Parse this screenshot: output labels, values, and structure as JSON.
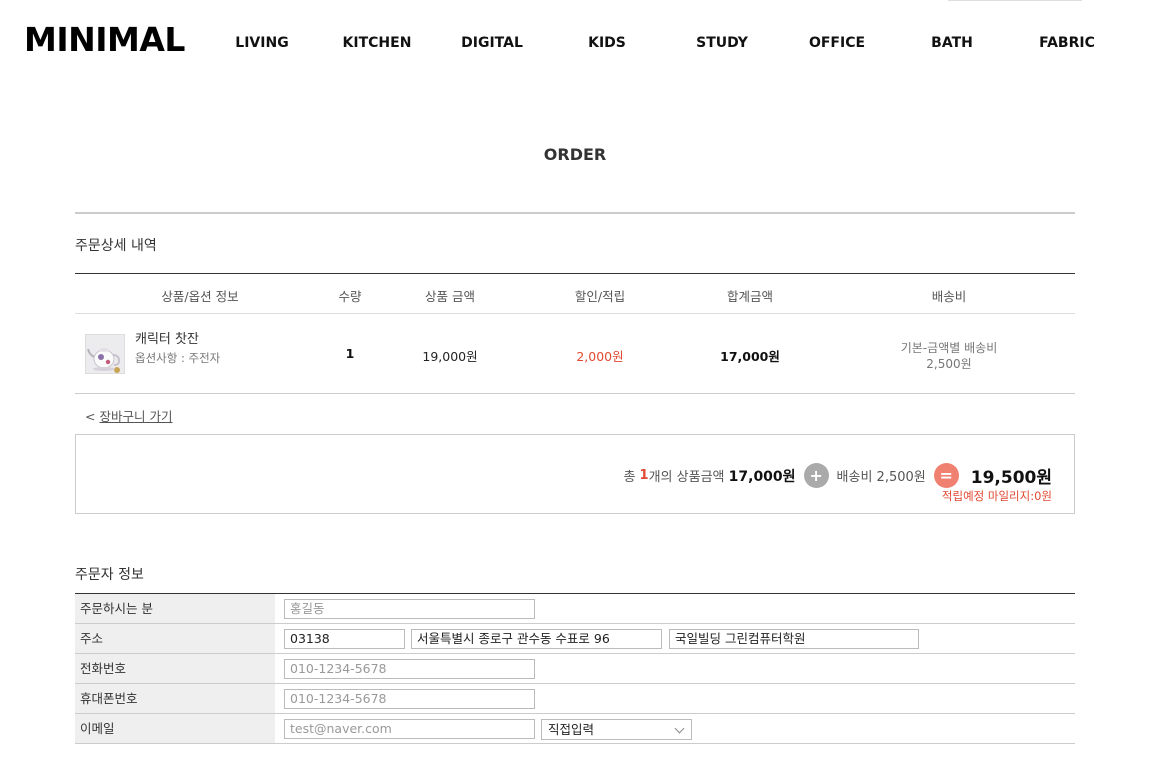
{
  "header": {
    "logo": "MINIMAL",
    "nav": [
      "LIVING",
      "KITCHEN",
      "DIGITAL",
      "KIDS",
      "STUDY",
      "OFFICE",
      "BATH",
      "FABRIC"
    ]
  },
  "page": {
    "title": "ORDER"
  },
  "order_detail": {
    "title": "주문상세 내역",
    "columns": [
      "상품/옵션 정보",
      "수량",
      "상품 금액",
      "할인/적립",
      "합계금액",
      "배송비"
    ],
    "items": [
      {
        "name": "캐릭터 찻잔",
        "option": "옵션사항 : 주전자",
        "quantity": "1",
        "price": "19,000원",
        "discount": "2,000원",
        "total": "17,000원",
        "shipping_type": "기본-금액별 배송비",
        "shipping_fee": "2,500원"
      }
    ],
    "cart_link": {
      "arrow": "<",
      "label": "장바구니 가기"
    }
  },
  "summary": {
    "prefix": "총",
    "count": "1",
    "count_suffix": "개의 상품금액",
    "products_total": "17,000원",
    "plus_symbol": "+",
    "shipping_label": "배송비 2,500원",
    "equals_symbol": "=",
    "grand_total": "19,500원",
    "mileage": "적립예정 마일리지:0원"
  },
  "orderer": {
    "title": "주문자 정보",
    "name_label": "주문하시는 분",
    "name_placeholder": "홍길동",
    "address_label": "주소",
    "zipcode": "03138",
    "address1": "서울특별시 종로구 관수동 수표로 96",
    "address2": "국일빌딩 그린컴퓨터학원",
    "phone_label": "전화번호",
    "phone_placeholder": "010-1234-5678",
    "mobile_label": "휴대폰번호",
    "mobile_placeholder": "010-1234-5678",
    "email_label": "이메일",
    "email_placeholder": "test@naver.com",
    "email_domain_selected": "직접입력"
  }
}
